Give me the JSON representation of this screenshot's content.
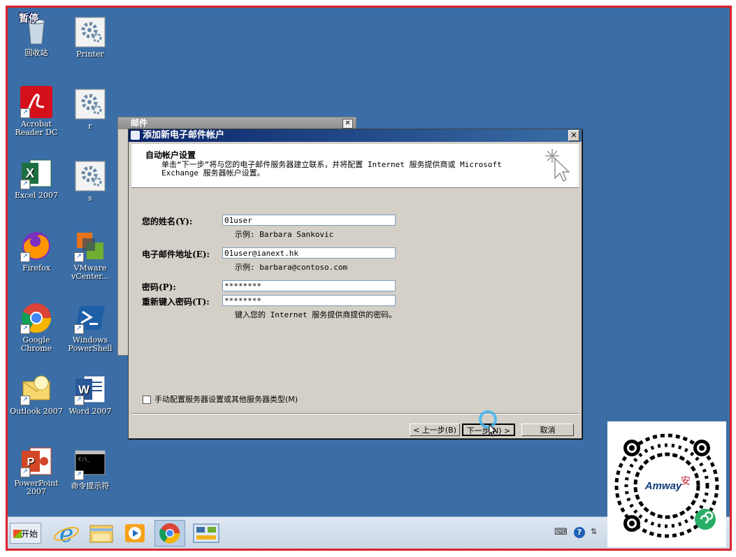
{
  "desktop": {
    "icons": [
      {
        "label": "回收站",
        "overlay": "暂停",
        "icon": "recycle-bin-icon"
      },
      {
        "label": "Printer",
        "icon": "settings-gear-icon"
      },
      {
        "label": "Acrobat\nReader DC",
        "icon": "acrobat-icon"
      },
      {
        "label": "r",
        "icon": "settings-gear-icon"
      },
      {
        "label": "Excel 2007",
        "icon": "excel-icon"
      },
      {
        "label": "s",
        "icon": "settings-gear-icon"
      },
      {
        "label": "Firefox",
        "icon": "firefox-icon"
      },
      {
        "label": "VMware\nvCenter...",
        "icon": "vmware-icon"
      },
      {
        "label": "Google\nChrome",
        "icon": "chrome-icon"
      },
      {
        "label": "Windows\nPowerShell",
        "icon": "powershell-icon"
      },
      {
        "label": "Outlook 2007",
        "icon": "outlook-icon"
      },
      {
        "label": "Word 2007",
        "icon": "word-icon"
      },
      {
        "label": "PowerPoint\n2007",
        "icon": "powerpoint-icon"
      },
      {
        "label": "命令提示符",
        "icon": "cmd-icon"
      }
    ]
  },
  "mail_window": {
    "title": "邮件",
    "close": "✕"
  },
  "dialog": {
    "title": "添加新电子邮件帐户",
    "close": "✕",
    "header_title": "自动帐户设置",
    "header_desc": "单击“下一步”将与您的电子邮件服务器建立联系，并将配置 Internet 服务提供商或 Microsoft Exchange 服务器帐户设置。",
    "name_label": "您的姓名(Y):",
    "name_value": "01user",
    "name_hint": "示例: Barbara Sankovic",
    "email_label": "电子邮件地址(E):",
    "email_value": "01user@ianext.hk",
    "email_hint": "示例: barbara@contoso.com",
    "password_label": "密码(P):",
    "password_value": "********",
    "repassword_label": "重新键入密码(T):",
    "repassword_value": "********",
    "password_hint": "键入您的 Internet 服务提供商提供的密码。",
    "manual_checkbox": "手动配置服务器设置或其他服务器类型(M)",
    "back_button": "< 上一步(B)",
    "next_button": "下一步(N) >",
    "cancel_button": "取消"
  },
  "taskbar": {
    "start_label": "开始",
    "apps": [
      "ie-icon",
      "explorer-icon",
      "media-player-icon",
      "chrome-icon",
      "control-panel-icon"
    ]
  },
  "colors": {
    "frame_border": "#d9252b",
    "desktop": "#3b6ea6",
    "titlebar": "#0a246a"
  }
}
